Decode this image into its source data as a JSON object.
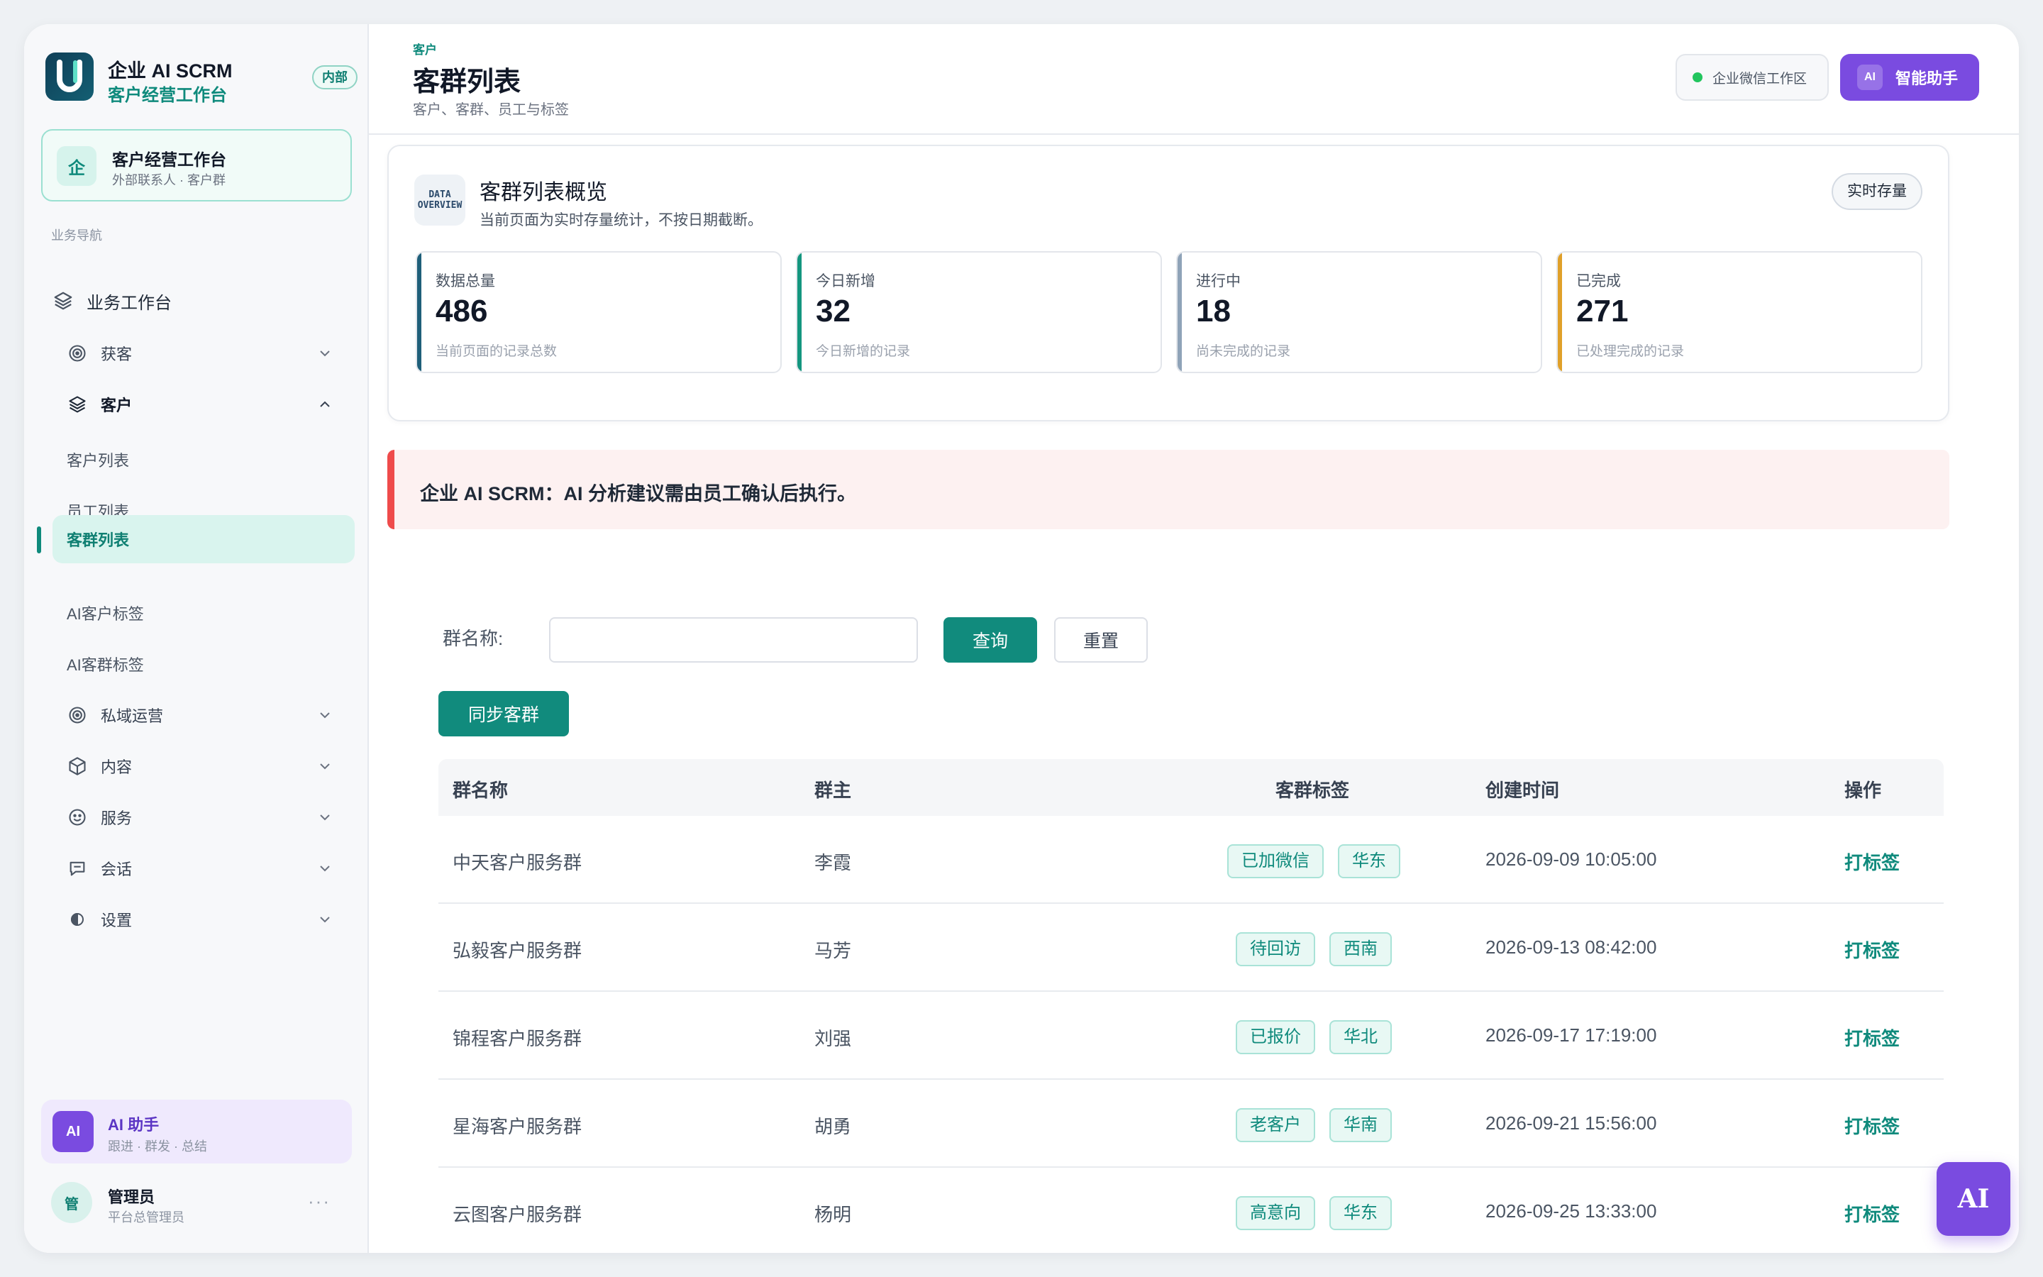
{
  "brand": {
    "name": "企业 AI SCRM",
    "subtitle": "客户经营工作台",
    "badge": "内部"
  },
  "workspace": {
    "icon": "企",
    "title": "客户经营工作台",
    "subtitle": "外部联系人 · 客户群"
  },
  "sidebar": {
    "section_label": "业务导航",
    "root": "业务工作台",
    "groups": {
      "acquire": "获客",
      "customer": "客户",
      "private": "私域运营",
      "content": "内容",
      "service": "服务",
      "chat": "会话",
      "settings": "设置"
    },
    "customer_items": [
      "客户列表",
      "员工列表",
      "客群列表",
      "AI客户标签",
      "AI客群标签"
    ],
    "active_item": "客群列表"
  },
  "ai_card": {
    "avatar": "AI",
    "title": "AI 助手",
    "subtitle": "跟进 · 群发 · 总结"
  },
  "user": {
    "avatar": "管",
    "name": "管理员",
    "role": "平台总管理员",
    "more": "···"
  },
  "header": {
    "breadcrumb": "客户",
    "title": "客群列表",
    "subtitle": "客户、客群、员工与标签",
    "wecom_label": "企业微信工作区",
    "assistant_tag": "AI",
    "assistant_label": "智能助手"
  },
  "overview": {
    "icon_line1": "DATA",
    "icon_line2": "OVERVIEW",
    "title": "客群列表概览",
    "subtitle": "当前页面为实时存量统计，不按日期截断。",
    "badge": "实时存量",
    "stats": [
      {
        "label": "数据总量",
        "value": "486",
        "desc": "当前页面的记录总数",
        "color": "#1f5f7a"
      },
      {
        "label": "今日新增",
        "value": "32",
        "desc": "今日新增的记录",
        "color": "#14967f"
      },
      {
        "label": "进行中",
        "value": "18",
        "desc": "尚未完成的记录",
        "color": "#8fa3b8"
      },
      {
        "label": "已完成",
        "value": "271",
        "desc": "已处理完成的记录",
        "color": "#e0a02a"
      }
    ]
  },
  "alert": {
    "text": "企业 AI SCRM：AI 分析建议需由员工确认后执行。"
  },
  "filter": {
    "label": "群名称:",
    "value": "",
    "placeholder": "",
    "query": "查询",
    "reset": "重置",
    "sync": "同步客群"
  },
  "table": {
    "headers": {
      "name": "群名称",
      "owner": "群主",
      "tags": "客群标签",
      "created": "创建时间",
      "action": "操作"
    },
    "rows": [
      {
        "name": "中天客户服务群",
        "owner": "李霞",
        "tag1": "已加微信",
        "tag2": "华东",
        "created": "2026-09-09 10:05:00",
        "action": "打标签"
      },
      {
        "name": "弘毅客户服务群",
        "owner": "马芳",
        "tag1": "待回访",
        "tag2": "西南",
        "created": "2026-09-13 08:42:00",
        "action": "打标签"
      },
      {
        "name": "锦程客户服务群",
        "owner": "刘强",
        "tag1": "已报价",
        "tag2": "华北",
        "created": "2026-09-17 17:19:00",
        "action": "打标签"
      },
      {
        "name": "星海客户服务群",
        "owner": "胡勇",
        "tag1": "老客户",
        "tag2": "华南",
        "created": "2026-09-21 15:56:00",
        "action": "打标签"
      },
      {
        "name": "云图客户服务群",
        "owner": "杨明",
        "tag1": "高意向",
        "tag2": "华东",
        "created": "2026-09-25 13:33:00",
        "action": "打标签"
      }
    ]
  },
  "fab": {
    "label": "AI"
  },
  "colors": {
    "primary": "#118b7d",
    "accent": "#7a4be0",
    "alert": "#ef4b4b"
  }
}
